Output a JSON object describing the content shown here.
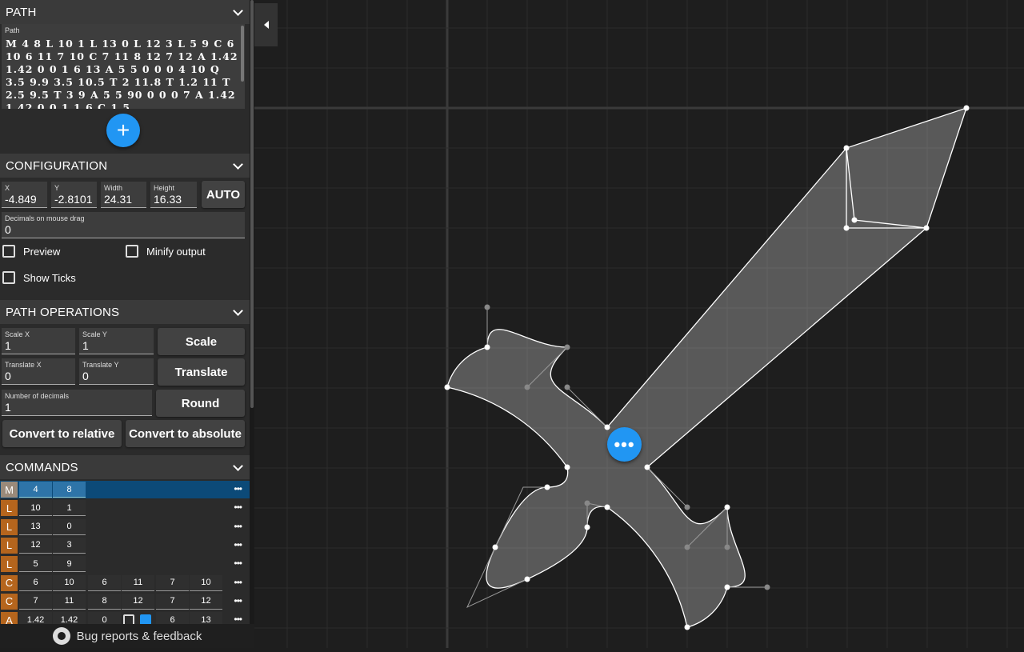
{
  "path_section": {
    "title": "PATH",
    "field_label": "Path",
    "path_value": "M 4 8 L 10 1 L 13 0 L 12 3 L 5 9 C 6 10 6 11 7 10 C 7 11 8 12 7 12 A 1.42 1.42 0 0 1 6 13 A 5 5 0 0 0 4 10 Q 3.5 9.9 3.5 10.5 T 2 11.8 T 1.2 11 T 2.5 9.5 T 3 9 A 5 5 90 0 0 0 7 A 1.42 1.42 0 0 1 1 6 C 1 5",
    "add_icon": "plus-icon",
    "add_label": "+"
  },
  "configuration": {
    "title": "CONFIGURATION",
    "x_label": "X",
    "x_value": "-4.849",
    "y_label": "Y",
    "y_value": "-2.8101",
    "width_label": "Width",
    "width_value": "24.31",
    "height_label": "Height",
    "height_value": "16.33",
    "auto_label": "AUTO",
    "decimals_label": "Decimals on mouse drag",
    "decimals_value": "0",
    "preview_label": "Preview",
    "minify_label": "Minify output",
    "ticks_label": "Show Ticks"
  },
  "path_operations": {
    "title": "PATH OPERATIONS",
    "scale_x_label": "Scale X",
    "scale_x_value": "1",
    "scale_y_label": "Scale Y",
    "scale_y_value": "1",
    "scale_button": "Scale",
    "translate_x_label": "Translate X",
    "translate_x_value": "0",
    "translate_y_label": "Translate Y",
    "translate_y_value": "0",
    "translate_button": "Translate",
    "decimals_label": "Number of decimals",
    "decimals_value": "1",
    "round_button": "Round",
    "relative_button": "Convert to relative",
    "absolute_button": "Convert to absolute"
  },
  "commands": {
    "title": "COMMANDS",
    "more_label": "•••",
    "rows": [
      {
        "cmd": "M",
        "vals": [
          "4",
          "8"
        ]
      },
      {
        "cmd": "L",
        "vals": [
          "10",
          "1"
        ]
      },
      {
        "cmd": "L",
        "vals": [
          "13",
          "0"
        ]
      },
      {
        "cmd": "L",
        "vals": [
          "12",
          "3"
        ]
      },
      {
        "cmd": "L",
        "vals": [
          "5",
          "9"
        ]
      },
      {
        "cmd": "C",
        "vals": [
          "6",
          "10",
          "6",
          "11",
          "7",
          "10"
        ]
      },
      {
        "cmd": "C",
        "vals": [
          "7",
          "11",
          "8",
          "12",
          "7",
          "12"
        ]
      },
      {
        "cmd": "A",
        "vals": [
          "1.42",
          "1.42",
          "0",
          "",
          "",
          "6",
          "13"
        ]
      }
    ]
  },
  "footer": {
    "icon": "github-icon",
    "label": "Bug reports & feedback"
  },
  "canvas": {
    "fab_label": "•••",
    "fab_icon": "more-horizontal-icon",
    "collapse_icon": "caret-left-icon"
  },
  "colors": {
    "accent": "#2196f3",
    "command_badge": "#b5651d",
    "selected_row": "#0c4a78",
    "panel": "#2b2b2b",
    "canvas_bg": "#1e1e1e"
  }
}
